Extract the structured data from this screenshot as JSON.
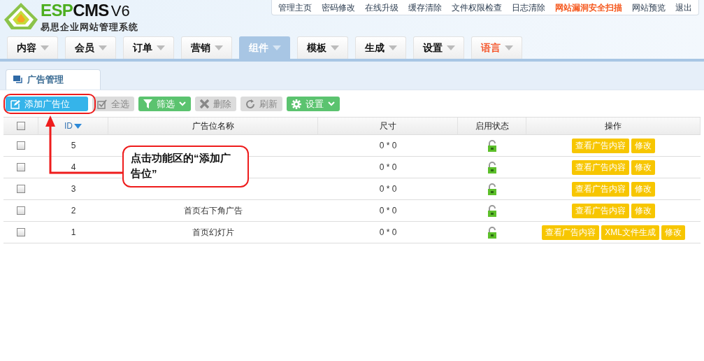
{
  "logo": {
    "brand_green": "ESP",
    "brand_dark": "CMS",
    "version": "V6",
    "subtitle": "易思企业网站管理系统"
  },
  "top_links": [
    {
      "label": "管理主页",
      "highlight": false
    },
    {
      "label": "密码修改",
      "highlight": false
    },
    {
      "label": "在线升级",
      "highlight": false
    },
    {
      "label": "缓存清除",
      "highlight": false
    },
    {
      "label": "文件权限检查",
      "highlight": false
    },
    {
      "label": "日志清除",
      "highlight": false
    },
    {
      "label": "网站漏洞安全扫描",
      "highlight": true
    },
    {
      "label": "网站预览",
      "highlight": false
    },
    {
      "label": "退出",
      "highlight": false
    }
  ],
  "nav": [
    {
      "label": "内容",
      "selected": false,
      "highlight": false
    },
    {
      "label": "会员",
      "selected": false,
      "highlight": false
    },
    {
      "label": "订单",
      "selected": false,
      "highlight": false
    },
    {
      "label": "营销",
      "selected": false,
      "highlight": false
    },
    {
      "label": "组件",
      "selected": true,
      "highlight": false
    },
    {
      "label": "模板",
      "selected": false,
      "highlight": false
    },
    {
      "label": "生成",
      "selected": false,
      "highlight": false
    },
    {
      "label": "设置",
      "selected": false,
      "highlight": false
    },
    {
      "label": "语言",
      "selected": false,
      "highlight": true
    }
  ],
  "panel_tab": {
    "label": "广告管理"
  },
  "toolbar": [
    {
      "label": "添加广告位",
      "kind": "primary",
      "dropdown": false
    },
    {
      "label": "全选",
      "kind": "plain",
      "dropdown": false
    },
    {
      "label": "筛选",
      "kind": "green",
      "dropdown": true
    },
    {
      "label": "删除",
      "kind": "plain",
      "dropdown": false
    },
    {
      "label": "刷新",
      "kind": "plain",
      "dropdown": false
    },
    {
      "label": "设置",
      "kind": "green",
      "dropdown": true
    }
  ],
  "table": {
    "select_all_checked": false,
    "columns": [
      {
        "label": "ID",
        "sorted": true
      },
      {
        "label": "广告位名称",
        "sorted": false
      },
      {
        "label": "尺寸",
        "sorted": false
      },
      {
        "label": "启用状态",
        "sorted": false
      },
      {
        "label": "操作",
        "sorted": false
      }
    ],
    "rows": [
      {
        "checked": false,
        "id": "5",
        "size": "0 * 0",
        "enabled": true,
        "actions": [
          "查看广告内容",
          "修改"
        ]
      },
      {
        "checked": false,
        "id": "4",
        "size": "0 * 0",
        "enabled": true,
        "actions": [
          "查看广告内容",
          "修改"
        ]
      },
      {
        "checked": false,
        "id": "3",
        "size": "0 * 0",
        "enabled": true,
        "actions": [
          "查看广告内容",
          "修改"
        ]
      },
      {
        "checked": false,
        "id": "2",
        "name": "首页右下角广告",
        "size": "0 * 0",
        "enabled": true,
        "actions": [
          "查看广告内容",
          "修改"
        ]
      },
      {
        "checked": false,
        "id": "1",
        "name": "首页幻灯片",
        "size": "0 * 0",
        "enabled": true,
        "actions": [
          "查看广告内容",
          "XML文件生成",
          "修改"
        ]
      }
    ]
  },
  "callout": {
    "text": "点击功能区的“添加广告位”"
  }
}
